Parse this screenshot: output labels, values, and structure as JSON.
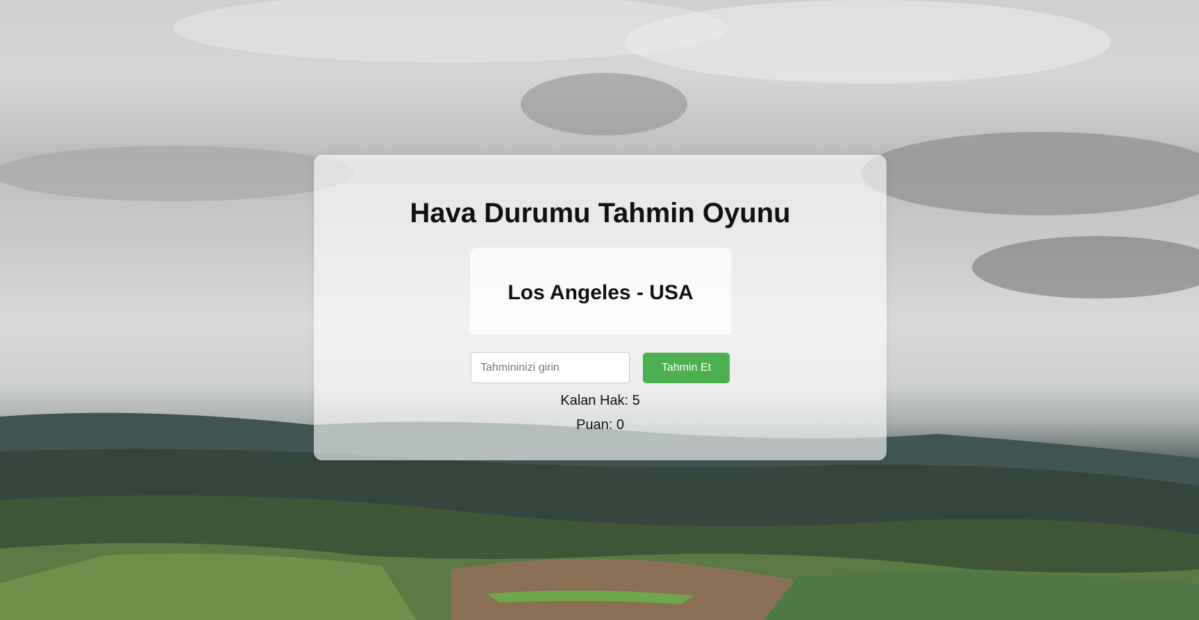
{
  "game": {
    "title": "Hava Durumu Tahmin Oyunu",
    "city": "Los Angeles - USA",
    "input_placeholder": "Tahmininizi girin",
    "input_value": "",
    "guess_button_label": "Tahmin Et",
    "remaining_label": "Kalan Hak: 5",
    "score_label": "Puan: 0"
  },
  "colors": {
    "button": "#4caf50",
    "card": "rgba(255,255,255,0.62)"
  }
}
